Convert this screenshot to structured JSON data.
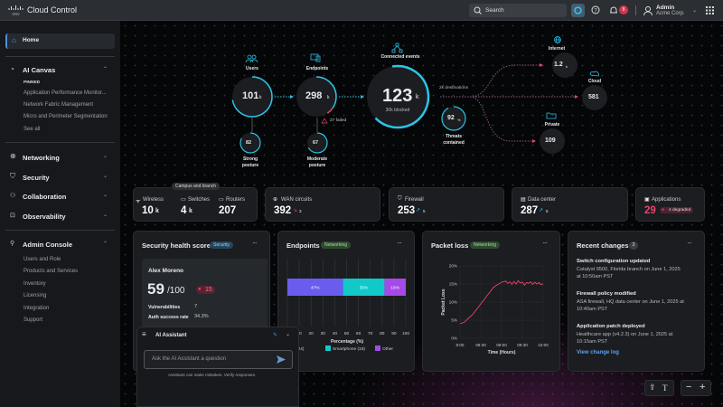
{
  "app": {
    "logo": "cisco",
    "title": "Cloud Control"
  },
  "topbar": {
    "search_placeholder": "Search",
    "notifications_count": "8",
    "user_name": "Admin",
    "user_org": "Acme Corp."
  },
  "sidebar": {
    "home": "Home",
    "ai_canvas": {
      "label": "AI Canvas",
      "pinned_label": "PINNED",
      "items": [
        "Application Performance Monitor...",
        "Network Fabric Management",
        "Micro and Perimeter Segmentation",
        "See all"
      ]
    },
    "sections": [
      "Networking",
      "Security",
      "Collaboration",
      "Observability"
    ],
    "admin": {
      "label": "Admin Console",
      "items": [
        "Users and Role",
        "Products and Services",
        "Inventory",
        "Licensing",
        "Integration",
        "Support"
      ]
    }
  },
  "flow": {
    "users": {
      "label": "Users",
      "value": "101",
      "unit": "k"
    },
    "endpoints": {
      "label": "Endpoints",
      "value": "298",
      "unit": "k",
      "failed": "27 failed"
    },
    "strong": {
      "value": "82",
      "label1": "Strong",
      "label2": "posture"
    },
    "moderate": {
      "value": "67",
      "label1": "Moderate",
      "label2": "posture"
    },
    "events": {
      "label": "Connected events",
      "value": "123",
      "unit": "k",
      "sub": "30k blocked"
    },
    "threats": {
      "value": "92",
      "unit": "%",
      "label1": "Threats",
      "label2": "contained"
    },
    "destinations": "2k destinations",
    "internet": {
      "label": "Internet",
      "value": "1.2",
      "unit": "k"
    },
    "cloud": {
      "label": "Cloud",
      "value": "581"
    },
    "private": {
      "label": "Private",
      "value": "109"
    }
  },
  "stats": {
    "campus_tab": "Campus and branch",
    "wireless": {
      "label": "Wireless",
      "value": "10",
      "unit": "k"
    },
    "switches": {
      "label": "Switches",
      "value": "4",
      "unit": "k"
    },
    "routers": {
      "label": "Routers",
      "value": "207"
    },
    "wan": {
      "label": "WAN circuits",
      "value": "392",
      "delta": "3"
    },
    "firewall": {
      "label": "Firewall",
      "value": "253",
      "delta": "5"
    },
    "datacenter": {
      "label": "Data center",
      "value": "287",
      "delta": "5"
    },
    "applications": {
      "label": "Applications",
      "value": "29",
      "badge": "4 degraded"
    }
  },
  "security": {
    "title": "Security health score",
    "tag": "Security",
    "user": "Alex Moreno",
    "score": "59",
    "max": "/100",
    "badge": "15",
    "rows": [
      {
        "k": "Vulnerabilities",
        "v": "7"
      },
      {
        "k": "Auth success rate",
        "v": "34.3%"
      }
    ]
  },
  "endpoints_panel": {
    "title": "Endpoints",
    "tag": "Networking"
  },
  "packet_panel": {
    "title": "Packet loss",
    "tag": "Networking"
  },
  "recent": {
    "title": "Recent changes",
    "count": "3",
    "items": [
      {
        "title": "Switch configuration updated",
        "line1": "Catalyst 9500, Florida branch on June 1, 2025",
        "line2": "at 10:50am PST"
      },
      {
        "title": "Firewall policy modified",
        "line1": "ASA firewall, HQ data center on June 1, 2025 at",
        "line2": "10:40am PST"
      },
      {
        "title": "Application patch deployed",
        "line1": "Healthcare app (v4.2.3) on June 1, 2025 at",
        "line2": "10:15am PST"
      }
    ],
    "link": "View change log"
  },
  "assistant": {
    "title": "AI Assistant",
    "placeholder": "Ask the AI Assistant a question",
    "disclaimer": "Assistant can make mistakes. Verify responses."
  },
  "colors": {
    "accent": "#2bc4e8",
    "danger": "#e8456b",
    "laptop": "#6b5cf0",
    "smartphone": "#12c9c9",
    "other": "#a54ae8",
    "line": "#e8456b"
  },
  "chart_data": [
    {
      "type": "bar",
      "orientation": "horizontal-stacked",
      "xlabel": "Percentage (%)",
      "xlim": [
        0,
        100
      ],
      "xticks": [
        0,
        10,
        20,
        30,
        40,
        50,
        60,
        70,
        80,
        90,
        100
      ],
      "series": [
        {
          "name": "Laptop (24)",
          "values": [
            47
          ]
        },
        {
          "name": "Smartphone (18)",
          "values": [
            35
          ]
        },
        {
          "name": "Other",
          "values": [
            18
          ]
        }
      ],
      "data_labels": [
        "47%",
        "35%",
        "18%"
      ],
      "legend": "bottom",
      "grid": true
    },
    {
      "type": "line",
      "xlabel": "Time (Hours)",
      "ylabel": "Packet Loss",
      "xticks": [
        "8:00",
        "08:30",
        "09:00",
        "09:30",
        "10:00"
      ],
      "yticks": [
        "0%",
        "5%",
        "10%",
        "15%",
        "20%"
      ],
      "ylim": [
        0,
        20
      ],
      "grid": true,
      "x": [
        8.0,
        8.1,
        8.2,
        8.3,
        8.4,
        8.5,
        8.6,
        8.7,
        8.8,
        8.9,
        9.0,
        9.1,
        9.15,
        9.2,
        9.25,
        9.3,
        9.35,
        9.4,
        9.45,
        9.5,
        9.55,
        9.6,
        9.65,
        9.7,
        9.75,
        9.8,
        9.85,
        9.9,
        9.95,
        10.0
      ],
      "y": [
        4,
        4.4,
        5.5,
        6.5,
        8,
        9.5,
        11,
        12.5,
        14,
        14.8,
        15.5,
        15.8,
        15.2,
        15.6,
        14.9,
        15.7,
        15.0,
        15.9,
        15.3,
        15.5,
        14.7,
        15.4,
        15.2,
        15.6,
        14.9,
        15.5,
        15.0,
        15.4,
        14.8,
        15.1
      ]
    }
  ]
}
